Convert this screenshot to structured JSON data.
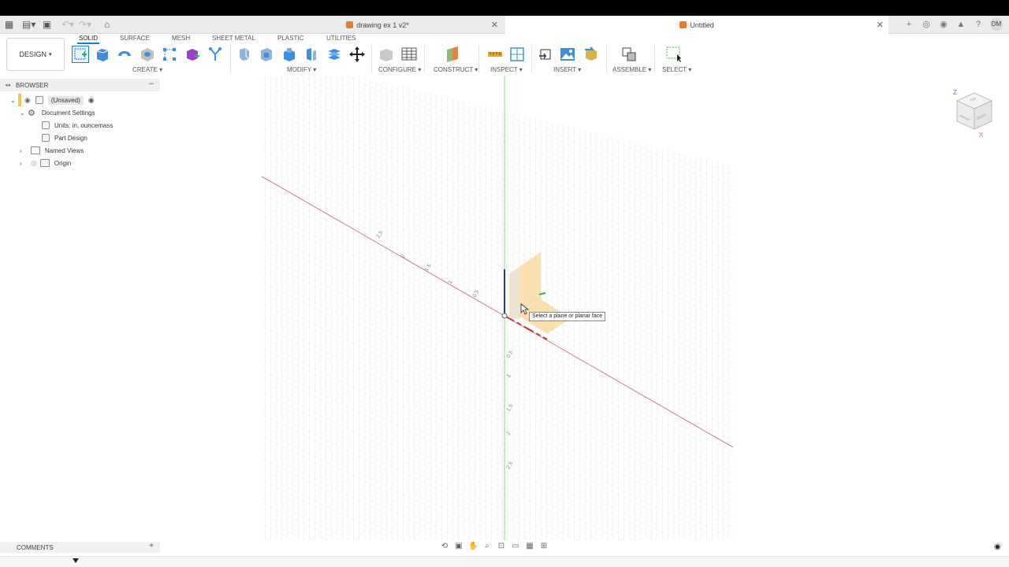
{
  "tabs": {
    "doc1": "drawing ex 1 v2*",
    "doc2": "Untitled"
  },
  "user": {
    "initials": "DM"
  },
  "toolbar": {
    "design": "DESIGN",
    "workspaces": [
      "SOLID",
      "SURFACE",
      "MESH",
      "SHEET METAL",
      "PLASTIC",
      "UTILITIES"
    ],
    "groups": {
      "create": "CREATE",
      "modify": "MODIFY",
      "configure": "CONFIGURE",
      "construct": "CONSTRUCT",
      "inspect": "INSPECT",
      "insert": "INSERT",
      "assemble": "ASSEMBLE",
      "select": "SELECT"
    }
  },
  "browser": {
    "title": "BROWSER",
    "root": "(Unsaved)",
    "document_settings": "Document Settings",
    "units": "Units: in, ouncemass",
    "part_design": "Part Design",
    "named_views": "Named Views",
    "origin": "Origin"
  },
  "viewport": {
    "tooltip": "Select a plane or planar face",
    "x_ticks": [
      "2.5",
      "2",
      "1.5",
      "1",
      "0.5"
    ],
    "y_ticks": [
      "0.5",
      "1",
      "1.5",
      "2",
      "2.5"
    ]
  },
  "viewcube": {
    "top": "TOP",
    "front": "FRONT",
    "right": "RIGHT",
    "z": "Z",
    "x": "X"
  },
  "comments": {
    "label": "COMMENTS"
  },
  "colors": {
    "accent": "#1f7ad2",
    "x_axis": "#c0392b",
    "y_axis": "#2ecc71",
    "z_axis": "#283593",
    "plane": "#f9d9a1"
  }
}
